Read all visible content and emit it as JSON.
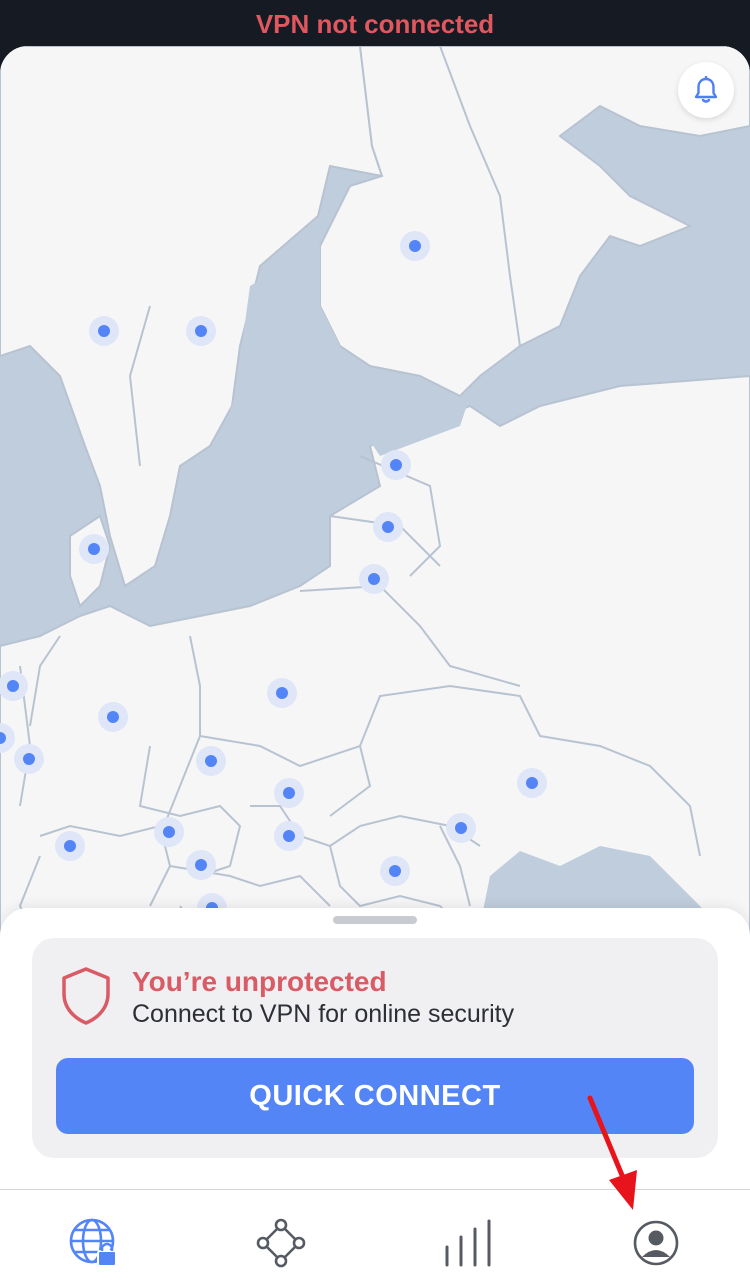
{
  "status": {
    "text": "VPN not connected"
  },
  "map": {
    "marker_count": 24
  },
  "card": {
    "title": "You’re unprotected",
    "subtitle": "Connect to VPN for online security",
    "button_label": "QUICK CONNECT"
  },
  "tabs": [
    {
      "icon": "globe-lock-icon",
      "active": true
    },
    {
      "icon": "meshnet-icon",
      "active": false
    },
    {
      "icon": "stats-bars-icon",
      "active": false
    },
    {
      "icon": "profile-icon",
      "active": false
    }
  ],
  "colors": {
    "alert_red": "#d95b65",
    "brand_blue": "#5485f7",
    "tab_inactive": "#555a63",
    "water": "#bfcddc",
    "land": "#f6f6f7",
    "status_bg": "#161a22",
    "annotation_arrow": "#e8141c"
  }
}
